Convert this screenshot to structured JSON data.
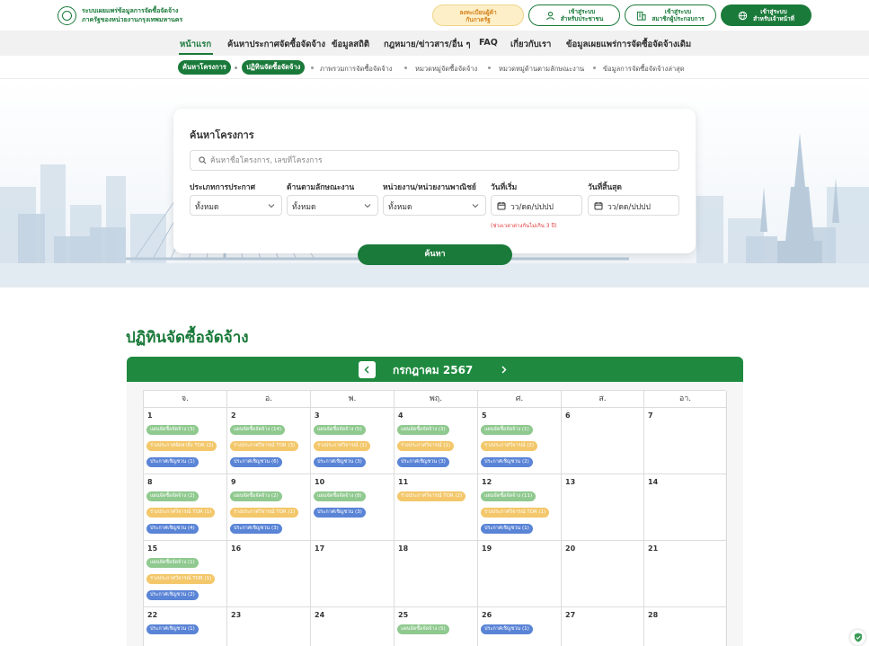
{
  "header": {
    "logo_line1": "ระบบเผยแพร่ข้อมูลการจัดซื้อจัดจ้าง",
    "logo_line2": "ภาครัฐของหน่วยงานกรุงเทพมหานคร",
    "register_line1": "ลงทะเบียนผู้ค้า",
    "register_line2": "กับภาครัฐ",
    "citizen_line1": "เข้าสู่ระบบ",
    "citizen_line2": "สำหรับประชาชน",
    "member_line1": "เข้าสู่ระบบ",
    "member_line2": "สมาชิกผู้ประกอบการ",
    "staff_line1": "เข้าสู่ระบบ",
    "staff_line2": "สำหรับเจ้าหน้าที่"
  },
  "nav": {
    "items": [
      {
        "label": "หน้าแรก"
      },
      {
        "label": "ค้นหาประกาศจัดซื้อจัดจ้าง"
      },
      {
        "label": "ข้อมูลสถิติ"
      },
      {
        "label": "กฎหมาย/ข่าวสาร/อื่น ๆ"
      },
      {
        "label": "FAQ"
      },
      {
        "label": "เกี่ยวกับเรา"
      },
      {
        "label": "ข้อมูลเผยแพร่การจัดซื้อจัดจ้างเดิม"
      }
    ]
  },
  "subnav": {
    "items": [
      {
        "label": "ค้นหาโครงการ"
      },
      {
        "label": "ปฏิทินจัดซื้อจัดจ้าง"
      },
      {
        "label": "ภาพรวมการจัดซื้อจัดจ้าง"
      },
      {
        "label": "หมวดหมู่จัดซื้อจัดจ้าง"
      },
      {
        "label": "หมวดหมู่ด้านตามลักษณะงาน"
      },
      {
        "label": "ข้อมูลการจัดซื้อจัดจ้างล่าสุด"
      }
    ]
  },
  "search": {
    "title": "ค้นหาโครงการ",
    "placeholder": "ค้นหาชื่อโครงการ, เลขที่โครงการ",
    "type_label": "ประเภทการประกาศ",
    "type_value": "ทั้งหมด",
    "category_label": "ด้านตามลักษณะงาน",
    "category_value": "ทั้งหมด",
    "agency_label": "หน่วยงาน/หน่วยงานพาณิชย์",
    "agency_value": "ทั้งหมด",
    "start_label": "วันที่เริ่ม",
    "start_value": "วว/ดด/ปปปป",
    "end_label": "วันที่สิ้นสุด",
    "end_value": "วว/ดด/ปปปป",
    "date_note": "(ช่วงเวลาต่างกันไม่เกิน 3 ปี)",
    "button": "ค้นหา"
  },
  "calendar": {
    "section_title": "ปฏิทินจัดซื้อจัดจ้าง",
    "month": "กรกฎาคม 2567",
    "weekdays": [
      "จ.",
      "อ.",
      "พ.",
      "พฤ.",
      "ศ.",
      "ส.",
      "อา."
    ],
    "weeks": [
      [
        {
          "day": "1",
          "events": [
            {
              "label": "แผนจัดซื้อจัดจ้าง (3)",
              "type": "green"
            },
            {
              "label": "ร่างประกาศจัดหาสิ่ง TOR (2)",
              "type": "orange"
            },
            {
              "label": "ประกาศเชิญชวน (1)",
              "type": "blue"
            }
          ]
        },
        {
          "day": "2",
          "events": [
            {
              "label": "แผนจัดซื้อจัดจ้าง (14)",
              "type": "green"
            },
            {
              "label": "ร่างประกาศวิจารณ์ TOR (3)",
              "type": "orange"
            },
            {
              "label": "ประกาศเชิญชวน (6)",
              "type": "blue"
            }
          ]
        },
        {
          "day": "3",
          "events": [
            {
              "label": "แผนจัดซื้อจัดจ้าง (5)",
              "type": "green"
            },
            {
              "label": "ร่างประกาศวิจารณ์ (1)",
              "type": "orange"
            },
            {
              "label": "ประกาศเชิญชวน (3)",
              "type": "blue"
            }
          ]
        },
        {
          "day": "4",
          "events": [
            {
              "label": "แผนจัดซื้อจัดจ้าง (3)",
              "type": "green"
            },
            {
              "label": "ร่างประกาศวิจารณ์ (1)",
              "type": "orange"
            },
            {
              "label": "ประกาศเชิญชวน (3)",
              "type": "blue"
            }
          ]
        },
        {
          "day": "5",
          "events": [
            {
              "label": "แผนจัดซื้อจัดจ้าง (1)",
              "type": "green"
            },
            {
              "label": "ร่างประกาศวิจารณ์ (2)",
              "type": "orange"
            },
            {
              "label": "ประกาศเชิญชวน (2)",
              "type": "blue"
            }
          ]
        },
        {
          "day": "6",
          "events": []
        },
        {
          "day": "7",
          "events": []
        }
      ],
      [
        {
          "day": "8",
          "events": [
            {
              "label": "แผนจัดซื้อจัดจ้าง (2)",
              "type": "green"
            },
            {
              "label": "ร่างประกาศวิจารณ์ TOR (1)",
              "type": "orange"
            },
            {
              "label": "ประกาศเชิญชวน (4)",
              "type": "blue"
            }
          ]
        },
        {
          "day": "9",
          "events": [
            {
              "label": "แผนจัดซื้อจัดจ้าง (2)",
              "type": "green"
            },
            {
              "label": "ร่างประกาศวิจารณ์ TOR (1)",
              "type": "orange"
            },
            {
              "label": "ประกาศเชิญชวน (3)",
              "type": "blue"
            }
          ]
        },
        {
          "day": "10",
          "events": [
            {
              "label": "แผนจัดซื้อจัดจ้าง (8)",
              "type": "green"
            },
            {
              "label": "ประกาศเชิญชวน (3)",
              "type": "blue"
            }
          ]
        },
        {
          "day": "11",
          "events": [
            {
              "label": "ร่างประกาศวิจารณ์ TOR (2)",
              "type": "orange"
            }
          ]
        },
        {
          "day": "12",
          "events": [
            {
              "label": "แผนจัดซื้อจัดจ้าง (11)",
              "type": "green"
            },
            {
              "label": "ร่างประกาศวิจารณ์ TOR (1)",
              "type": "orange"
            },
            {
              "label": "ประกาศเชิญชวน (1)",
              "type": "blue"
            }
          ]
        },
        {
          "day": "13",
          "events": []
        },
        {
          "day": "14",
          "events": []
        }
      ],
      [
        {
          "day": "15",
          "events": [
            {
              "label": "แผนจัดซื้อจัดจ้าง (1)",
              "type": "green"
            },
            {
              "label": "ร่างประกาศวิจารณ์ TOR (1)",
              "type": "orange"
            },
            {
              "label": "ประกาศเชิญชวน (2)",
              "type": "blue"
            }
          ]
        },
        {
          "day": "16",
          "events": []
        },
        {
          "day": "17",
          "events": []
        },
        {
          "day": "18",
          "events": []
        },
        {
          "day": "19",
          "events": []
        },
        {
          "day": "20",
          "events": []
        },
        {
          "day": "21",
          "events": []
        }
      ],
      [
        {
          "day": "22",
          "events": [
            {
              "label": "ประกาศเชิญชวน (1)",
              "type": "blue"
            }
          ]
        },
        {
          "day": "23",
          "events": []
        },
        {
          "day": "24",
          "events": []
        },
        {
          "day": "25",
          "events": [
            {
              "label": "แผนจัดซื้อจัดจ้าง (5)",
              "type": "green"
            }
          ]
        },
        {
          "day": "26",
          "events": [
            {
              "label": "ประกาศเชิญชวน (1)",
              "type": "blue"
            }
          ]
        },
        {
          "day": "27",
          "events": []
        },
        {
          "day": "28",
          "events": []
        }
      ]
    ]
  },
  "colors": {
    "primary": "#1a7a3a",
    "event_green": "#8fc98f",
    "event_orange": "#f3c76a",
    "event_blue": "#5a84d6",
    "error": "#e03a3a"
  }
}
